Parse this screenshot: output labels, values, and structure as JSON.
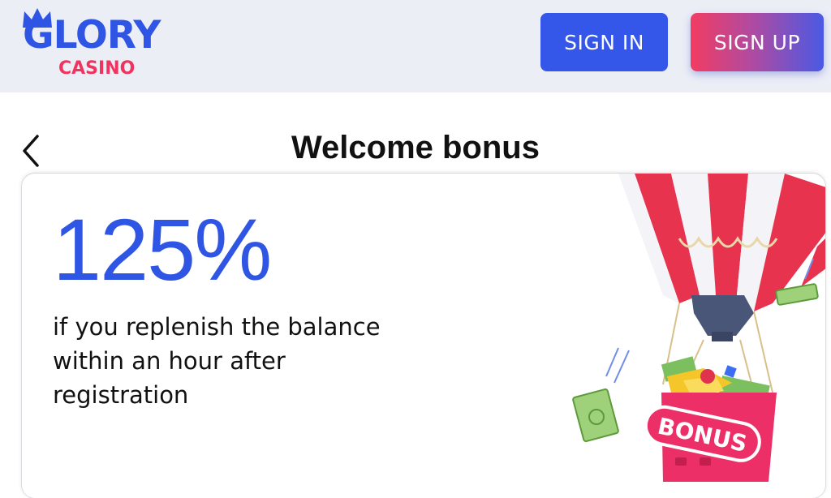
{
  "brand": {
    "logo_main": "GLORY",
    "logo_sub": "CASINO"
  },
  "header": {
    "signin_label": "SIGN IN",
    "signup_label": "SIGN UP"
  },
  "page": {
    "title": "Welcome bonus"
  },
  "bonus": {
    "headline": "125%",
    "description": "if you replenish the balance within an hour after registration",
    "badge": "BONUS"
  },
  "colors": {
    "brand_blue": "#2f55e4",
    "brand_pink": "#f0345f",
    "header_bg": "#eceef6"
  },
  "icons": {
    "back": "chevron-left-icon",
    "crown": "crown-icon"
  }
}
